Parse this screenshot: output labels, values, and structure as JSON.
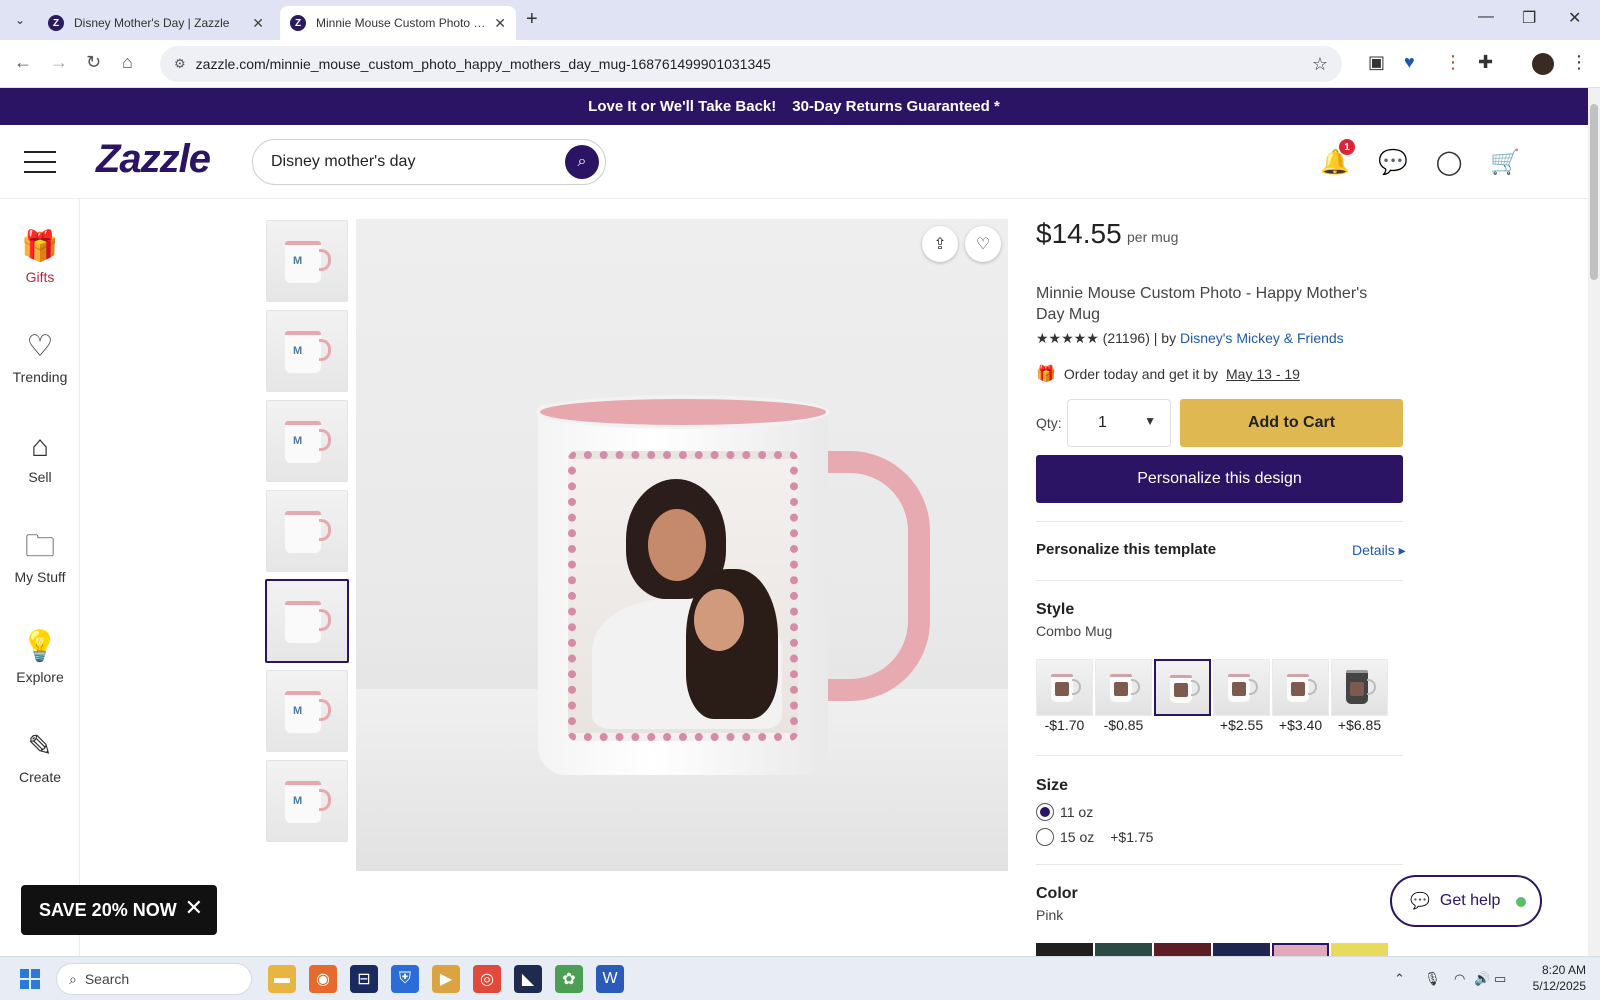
{
  "browser": {
    "tabs": [
      {
        "title": "Disney Mother's Day | Zazzle",
        "active": false
      },
      {
        "title": "Minnie Mouse Custom Photo - Ha",
        "active": true
      }
    ],
    "address": "zazzle.com/minnie_mouse_custom_photo_happy_mothers_day_mug-168761499901031345"
  },
  "promo": {
    "text1": "Love It or We'll Take Back!",
    "text2": "30-Day Returns Guaranteed *"
  },
  "header": {
    "logo": "Zazzle",
    "search_value": "Disney mother's day",
    "notification_count": "1"
  },
  "leftnav": {
    "items": [
      {
        "label": "Gifts",
        "icon": "gift-icon"
      },
      {
        "label": "Trending",
        "icon": "trending-icon"
      },
      {
        "label": "Sell",
        "icon": "store-icon"
      },
      {
        "label": "My Stuff",
        "icon": "folder-icon"
      },
      {
        "label": "Explore",
        "icon": "bulb-icon"
      },
      {
        "label": "Create",
        "icon": "magic-wand-icon"
      }
    ]
  },
  "product": {
    "price": "$14.55",
    "per_unit": "per mug",
    "title": "Minnie Mouse Custom Photo - Happy Mother's Day Mug",
    "stars": "★★★★★",
    "review_count": "(21196)",
    "by": "| by",
    "seller": "Disney's Mickey & Friends",
    "delivery_prefix": "Order today and get it by",
    "delivery_date": "May 13 - 19",
    "qty_label": "Qty:",
    "qty_value": "1",
    "add_to_cart": "Add to Cart",
    "personalize_button": "Personalize this design",
    "personalize_template": "Personalize this template",
    "details": "Details",
    "style_heading": "Style",
    "style_value": "Combo Mug",
    "style_prices": [
      "-$1.70",
      "-$0.85",
      "",
      "+$2.55",
      "+$3.40",
      "+$6.85"
    ],
    "selected_style_index": 2,
    "size_heading": "Size",
    "sizes": [
      {
        "label": "11 oz",
        "extra": "",
        "checked": true
      },
      {
        "label": "15 oz",
        "extra": "+$1.75",
        "checked": false
      }
    ],
    "color_heading": "Color",
    "color_value": "Pink",
    "colors": [
      "#1f1f1f",
      "#2c4a44",
      "#5a1e24",
      "#1f2550",
      "#e0a8b8",
      "#e8da5a"
    ],
    "selected_color_index": 4
  },
  "floating": {
    "save_label": "SAVE 20% NOW",
    "help_label": "Get help"
  },
  "taskbar": {
    "search_placeholder": "Search",
    "time": "8:20 AM",
    "date": "5/12/2025"
  }
}
